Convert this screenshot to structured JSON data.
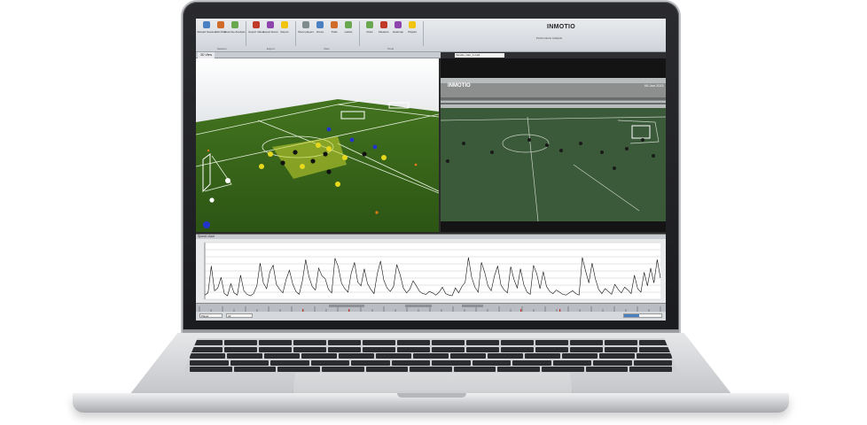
{
  "app": {
    "brand": "INMOTIO",
    "brand_sub": "Performance Analysis",
    "ribbon_groups": [
      {
        "label": "Session",
        "buttons": [
          "Reload Session",
          "Edit Filter",
          "Exercise Analysis"
        ]
      },
      {
        "label": "Export",
        "buttons": [
          "Export Video",
          "Export Excel",
          "Report"
        ]
      },
      {
        "label": "View",
        "buttons": [
          "Show players",
          "Zones",
          "Trails",
          "Labels"
        ]
      },
      {
        "label": "Tools",
        "buttons": [
          "Draw",
          "Measure",
          "Heatmap",
          "Playlist"
        ]
      }
    ],
    "tabs": {
      "view3d_label": "3D View",
      "video_select": "Inmotio_cam_1.mp4"
    },
    "video": {
      "logo": "INMOTIO",
      "date": "06 Jan 2021"
    },
    "chart_panel_title": "Speed chart",
    "status": {
      "field1": "Player",
      "field2": "All",
      "text": "",
      "progress": 0.4
    },
    "colors": {
      "pitch": "#2f5a1a",
      "accent_orange": "#e07b1a",
      "series": "#111111",
      "highlight": "#c8d630"
    }
  },
  "chart_data": {
    "type": "line",
    "title": "",
    "xlabel": "",
    "ylabel": "",
    "ylim": [
      0,
      8
    ],
    "series": [
      {
        "values": [
          0.6,
          0.9,
          4.7,
          1.2,
          1.6,
          3.1,
          0.8,
          0.5,
          2.2,
          0.9,
          0.6,
          3.4,
          1.2,
          0.7,
          0.5,
          0.8,
          1.9,
          5.1,
          2.3,
          1.5,
          3.9,
          4.8,
          2.1,
          1.4,
          0.9,
          2.8,
          4.1,
          2.2,
          1.1,
          0.7,
          2.6,
          5.6,
          3.2,
          1.8,
          1.3,
          4.4,
          3.3,
          2.9,
          1.4,
          0.9,
          5.8,
          4.6,
          2.3,
          1.5,
          1.0,
          3.7,
          5.2,
          2.4,
          1.9,
          4.3,
          2.2,
          1.4,
          0.8,
          3.6,
          5.4,
          2.7,
          1.6,
          1.1,
          1.8,
          4.9,
          3.5,
          1.6,
          0.9,
          1.4,
          2.6,
          1.9,
          1.1,
          0.8,
          0.7,
          1.1,
          0.9,
          0.6,
          1.0,
          1.7,
          0.8,
          0.6,
          0.5,
          1.6,
          0.9,
          1.8,
          2.4,
          5.9,
          3.1,
          1.7,
          1.0,
          5.2,
          3.8,
          1.9,
          1.2,
          3.3,
          4.7,
          2.0,
          1.3,
          0.9,
          4.6,
          2.8,
          1.6,
          4.3,
          2.1,
          1.0,
          0.7,
          4.8,
          3.6,
          1.5,
          3.9,
          1.8,
          1.1,
          0.8,
          1.3,
          1.0,
          0.7,
          0.6,
          0.9,
          1.2,
          0.8,
          0.6,
          5.9,
          4.0,
          2.3,
          5.1,
          2.9,
          1.4,
          0.8,
          1.5,
          1.1,
          0.7,
          2.1,
          1.4,
          0.9,
          1.7,
          1.3,
          0.8,
          3.4,
          1.5,
          1.0,
          3.8,
          1.9,
          4.4,
          2.3,
          5.6,
          3.0
        ]
      }
    ],
    "grid": true
  }
}
